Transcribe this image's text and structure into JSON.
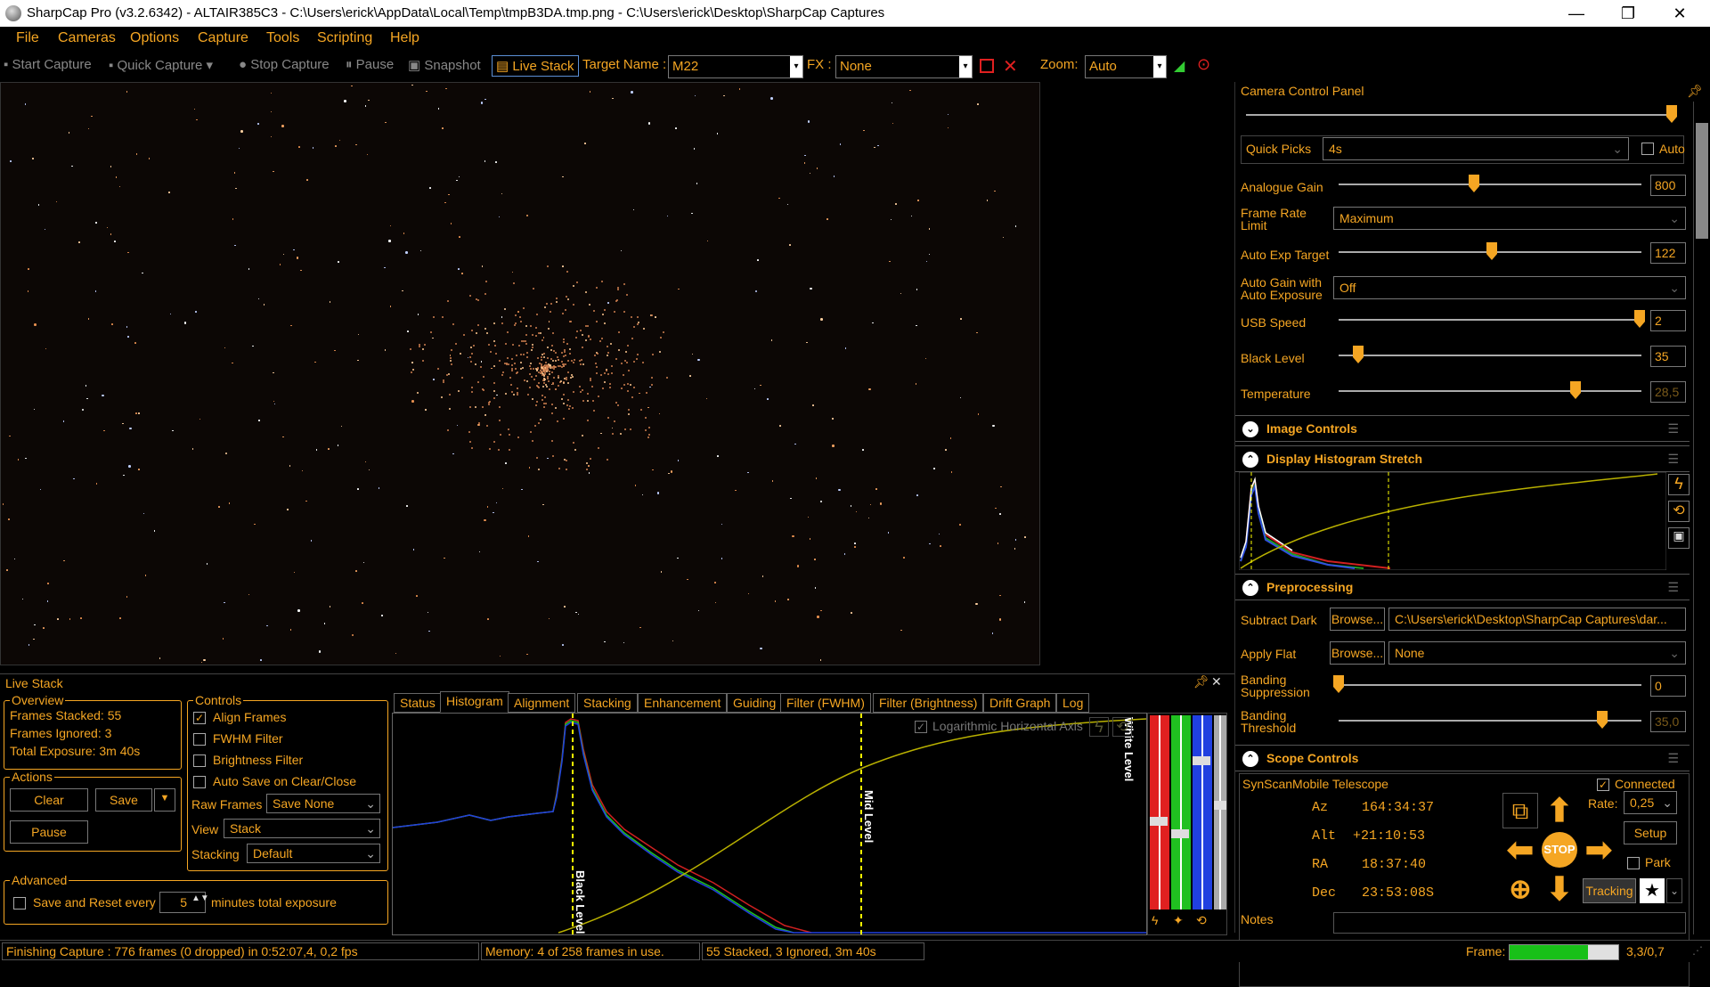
{
  "window": {
    "title": "SharpCap Pro (v3.2.6342) - ALTAIR385C3 - C:\\Users\\erick\\AppData\\Local\\Temp\\tmpB3DA.tmp.png - C:\\Users\\erick\\Desktop\\SharpCap Captures",
    "minimize": "—",
    "restore": "❐",
    "close": "✕"
  },
  "menu": [
    "File",
    "Cameras",
    "Options",
    "Capture",
    "Tools",
    "Scripting",
    "Help"
  ],
  "toolbar": {
    "start_capture": "Start Capture",
    "quick_capture": "Quick Capture",
    "stop_capture": "Stop Capture",
    "pause": "Pause",
    "snapshot": "Snapshot",
    "live_stack": "Live Stack",
    "target_name_label": "Target Name :",
    "target_name_value": "M22",
    "fx_label": "FX :",
    "fx_value": "None",
    "zoom_label": "Zoom:",
    "zoom_value": "Auto"
  },
  "camera_panel": {
    "title": "Camera Control Panel",
    "quick_picks_label": "Quick Picks",
    "quick_picks_value": "4s",
    "auto_label": "Auto",
    "analogue_gain_label": "Analogue Gain",
    "analogue_gain_value": "800",
    "frame_rate_label_1": "Frame Rate",
    "frame_rate_label_2": "Limit",
    "frame_rate_value": "Maximum",
    "auto_exp_target_label": "Auto Exp Target",
    "auto_exp_target_value": "122",
    "auto_gain_label_1": "Auto Gain with",
    "auto_gain_label_2": "Auto Exposure",
    "auto_gain_value": "Off",
    "usb_speed_label": "USB Speed",
    "usb_speed_value": "2",
    "black_level_label": "Black Level",
    "black_level_value": "35",
    "temperature_label": "Temperature",
    "temperature_value": "28,5"
  },
  "sections": {
    "image_controls": "Image Controls",
    "display_histogram_stretch": "Display Histogram Stretch",
    "preprocessing": "Preprocessing",
    "scope_controls": "Scope Controls"
  },
  "preprocessing": {
    "subtract_dark_label": "Subtract Dark",
    "browse": "Browse...",
    "subtract_dark_value": "C:\\Users\\erick\\Desktop\\SharpCap Captures\\dar...",
    "apply_flat_label": "Apply Flat",
    "apply_flat_value": "None",
    "banding_suppression_1": "Banding",
    "banding_suppression_2": "Suppression",
    "banding_suppression_value": "0",
    "banding_threshold_1": "Banding",
    "banding_threshold_2": "Threshold",
    "banding_threshold_value": "35,0"
  },
  "scope": {
    "telescope": "SynScanMobile Telescope",
    "connected_label": "Connected",
    "az_label": "Az",
    "az_value": "164:34:37",
    "alt_label": "Alt",
    "alt_value": "+21:10:53",
    "ra_label": "RA",
    "ra_value": "18:37:40",
    "dec_label": "Dec",
    "dec_value": "23:53:08S",
    "rate_label": "Rate:",
    "rate_value": "0,25",
    "setup": "Setup",
    "park": "Park",
    "tracking": "Tracking",
    "stop": "STOP"
  },
  "notes_label": "Notes",
  "live_stack": {
    "title": "Live Stack",
    "overview_title": "Overview",
    "frames_stacked": "Frames Stacked:  55",
    "frames_ignored": "Frames Ignored:  3",
    "total_exposure": "Total Exposure:   3m 40s",
    "actions_title": "Actions",
    "clear": "Clear",
    "save": "Save",
    "pause": "Pause",
    "advanced_title": "Advanced",
    "save_reset_label": "Save and Reset every",
    "save_reset_value": "5",
    "minutes_label": "minutes total exposure",
    "controls_title": "Controls",
    "align_frames": "Align Frames",
    "fwhm_filter": "FWHM Filter",
    "brightness_filter": "Brightness Filter",
    "auto_save": "Auto Save on Clear/Close",
    "raw_frames_label": "Raw Frames",
    "raw_frames_value": "Save None",
    "view_label": "View",
    "view_value": "Stack",
    "stacking_label": "Stacking",
    "stacking_value": "Default",
    "tabs": [
      "Status",
      "Histogram",
      "Alignment",
      "Stacking",
      "Enhancement",
      "Guiding",
      "Filter (FWHM)",
      "Filter (Brightness)",
      "Drift Graph",
      "Log"
    ],
    "log_axis_label": "Logarithmic Horizontal Axis",
    "black_level_marker": "Black Level",
    "mid_level_marker": "Mid Level",
    "white_level_marker": "White Level"
  },
  "status": {
    "capture": "Finishing Capture : 776 frames (0 dropped) in 0:52:07,4, 0,2 fps",
    "memory": "Memory: 4 of 258 frames in use.",
    "stacked": "55 Stacked, 3 Ignored, 3m 40s",
    "frame_label": "Frame:",
    "frame_value": "3,3/0,7",
    "frame_progress": 0.72
  },
  "colors": {
    "accent": "#f5a623",
    "background": "#000000",
    "curve": "#b8b000",
    "marker": "#ffff00"
  }
}
